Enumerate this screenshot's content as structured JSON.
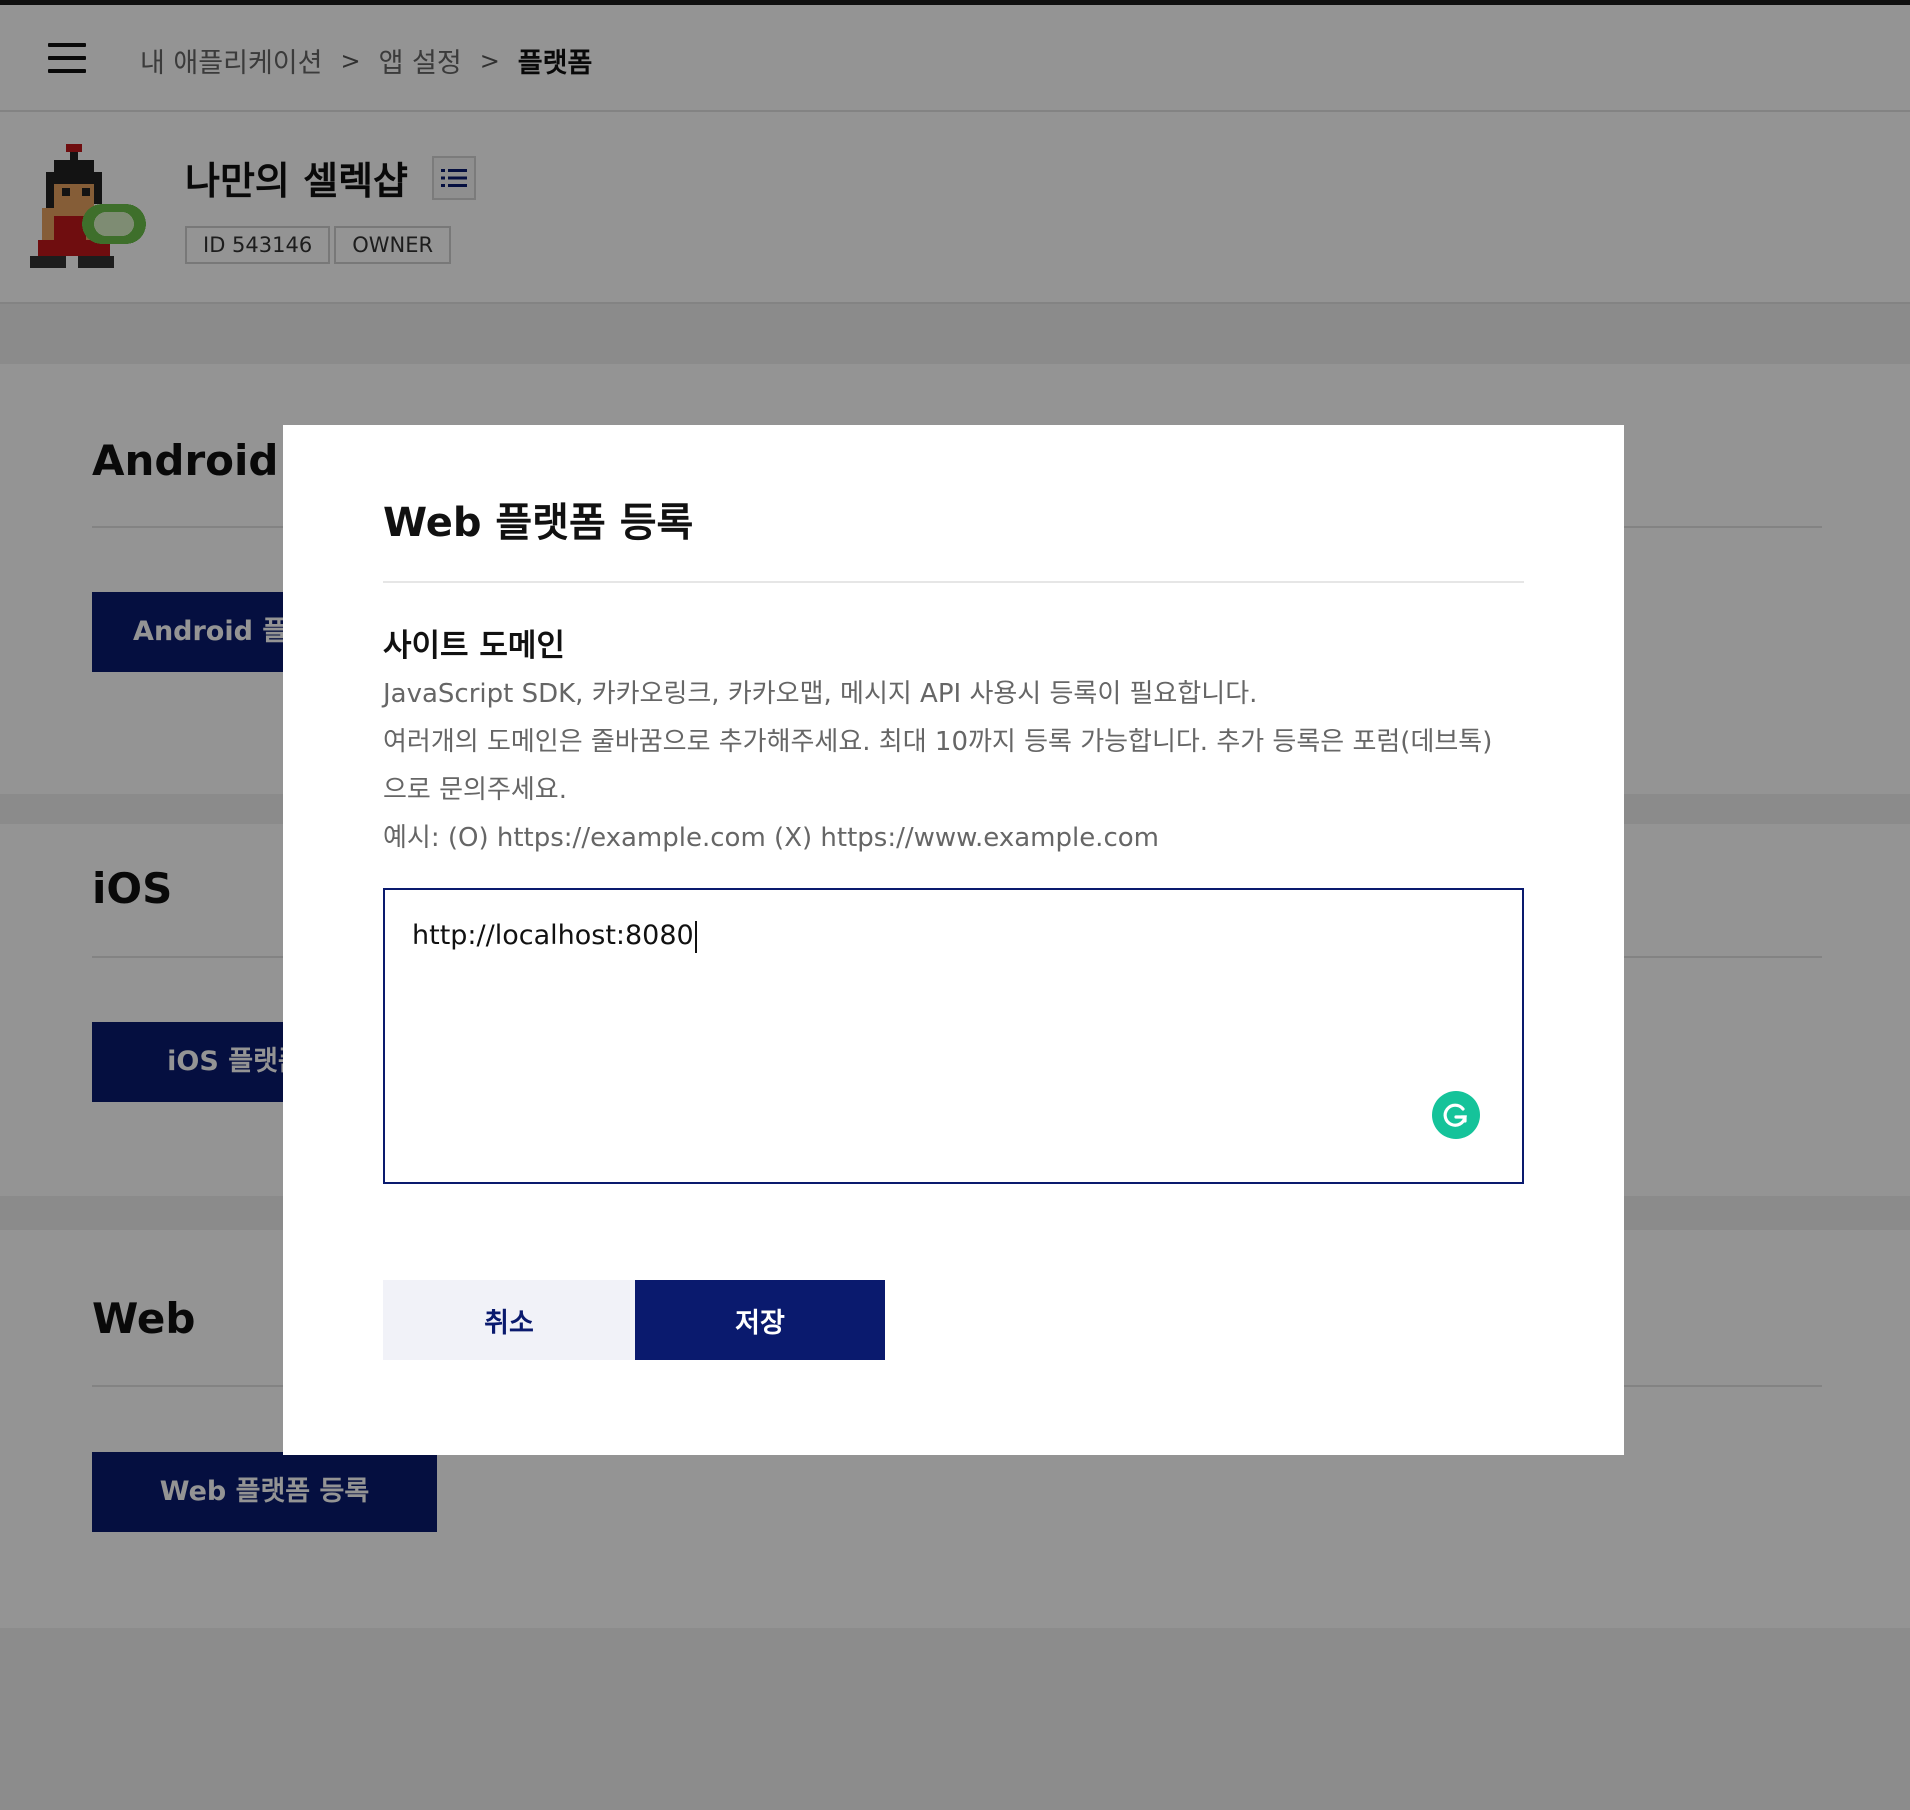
{
  "breadcrumb": {
    "items": [
      "내 애플리케이션",
      "앱 설정",
      "플랫폼"
    ],
    "separator": ">"
  },
  "app": {
    "name": "나만의 셀렉샵",
    "id_badge": "ID 543146",
    "role_badge": "OWNER"
  },
  "sections": {
    "android": {
      "title": "Android",
      "button_label": "Android 플랫폼 등록"
    },
    "ios": {
      "title": "iOS",
      "button_label": "iOS 플랫폼 등록"
    },
    "web": {
      "title": "Web",
      "button_label": "Web 플랫폼 등록"
    }
  },
  "modal": {
    "title": "Web 플랫폼 등록",
    "field_label": "사이트 도메인",
    "help_lines": [
      "JavaScript SDK, 카카오링크, 카카오맵, 메시지 API 사용시 등록이 필요합니다.",
      "여러개의 도메인은 줄바꿈으로 추가해주세요. 최대 10까지 등록 가능합니다. 추가 등록은 포럼(데브톡)",
      "으로 문의주세요.",
      "예시: (O) https://example.com (X) https://www.example.com"
    ],
    "textarea_value": "http://localhost:8080",
    "cancel_label": "취소",
    "save_label": "저장"
  },
  "colors": {
    "primary": "#0a1a6e",
    "cancel_bg": "#f1f2f8",
    "grammarly": "#15c39a"
  },
  "icons": [
    "menu-icon",
    "app-avatar-icon",
    "list-icon",
    "grammarly-icon"
  ]
}
